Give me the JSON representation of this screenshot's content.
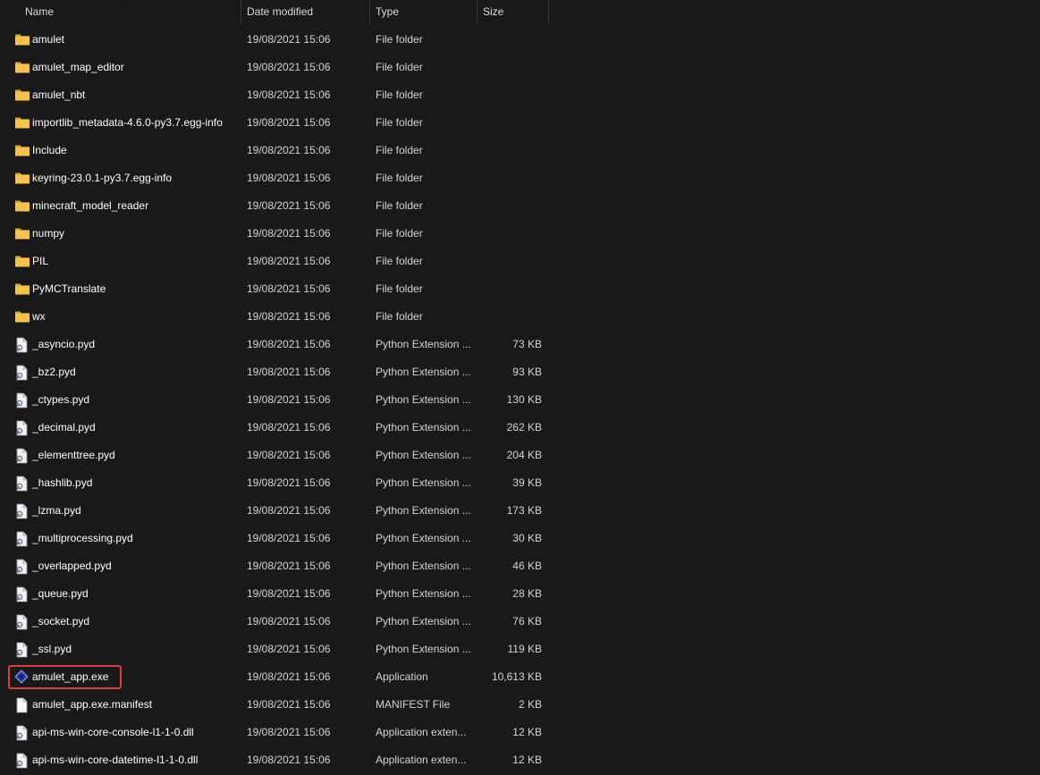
{
  "columns": {
    "name": "Name",
    "date": "Date modified",
    "type": "Type",
    "size": "Size"
  },
  "files": [
    {
      "name": "amulet",
      "date": "19/08/2021 15:06",
      "type": "File folder",
      "size": "",
      "icon": "folder-icon"
    },
    {
      "name": "amulet_map_editor",
      "date": "19/08/2021 15:06",
      "type": "File folder",
      "size": "",
      "icon": "folder-icon"
    },
    {
      "name": "amulet_nbt",
      "date": "19/08/2021 15:06",
      "type": "File folder",
      "size": "",
      "icon": "folder-icon"
    },
    {
      "name": "importlib_metadata-4.6.0-py3.7.egg-info",
      "date": "19/08/2021 15:06",
      "type": "File folder",
      "size": "",
      "icon": "folder-icon"
    },
    {
      "name": "Include",
      "date": "19/08/2021 15:06",
      "type": "File folder",
      "size": "",
      "icon": "folder-icon"
    },
    {
      "name": "keyring-23.0.1-py3.7.egg-info",
      "date": "19/08/2021 15:06",
      "type": "File folder",
      "size": "",
      "icon": "folder-icon"
    },
    {
      "name": "minecraft_model_reader",
      "date": "19/08/2021 15:06",
      "type": "File folder",
      "size": "",
      "icon": "folder-icon"
    },
    {
      "name": "numpy",
      "date": "19/08/2021 15:06",
      "type": "File folder",
      "size": "",
      "icon": "folder-icon"
    },
    {
      "name": "PIL",
      "date": "19/08/2021 15:06",
      "type": "File folder",
      "size": "",
      "icon": "folder-icon"
    },
    {
      "name": "PyMCTranslate",
      "date": "19/08/2021 15:06",
      "type": "File folder",
      "size": "",
      "icon": "folder-icon"
    },
    {
      "name": "wx",
      "date": "19/08/2021 15:06",
      "type": "File folder",
      "size": "",
      "icon": "folder-icon"
    },
    {
      "name": "_asyncio.pyd",
      "date": "19/08/2021 15:06",
      "type": "Python Extension ...",
      "size": "73 KB",
      "icon": "extension-file-icon"
    },
    {
      "name": "_bz2.pyd",
      "date": "19/08/2021 15:06",
      "type": "Python Extension ...",
      "size": "93 KB",
      "icon": "extension-file-icon"
    },
    {
      "name": "_ctypes.pyd",
      "date": "19/08/2021 15:06",
      "type": "Python Extension ...",
      "size": "130 KB",
      "icon": "extension-file-icon"
    },
    {
      "name": "_decimal.pyd",
      "date": "19/08/2021 15:06",
      "type": "Python Extension ...",
      "size": "262 KB",
      "icon": "extension-file-icon"
    },
    {
      "name": "_elementtree.pyd",
      "date": "19/08/2021 15:06",
      "type": "Python Extension ...",
      "size": "204 KB",
      "icon": "extension-file-icon"
    },
    {
      "name": "_hashlib.pyd",
      "date": "19/08/2021 15:06",
      "type": "Python Extension ...",
      "size": "39 KB",
      "icon": "extension-file-icon"
    },
    {
      "name": "_lzma.pyd",
      "date": "19/08/2021 15:06",
      "type": "Python Extension ...",
      "size": "173 KB",
      "icon": "extension-file-icon"
    },
    {
      "name": "_multiprocessing.pyd",
      "date": "19/08/2021 15:06",
      "type": "Python Extension ...",
      "size": "30 KB",
      "icon": "extension-file-icon"
    },
    {
      "name": "_overlapped.pyd",
      "date": "19/08/2021 15:06",
      "type": "Python Extension ...",
      "size": "46 KB",
      "icon": "extension-file-icon"
    },
    {
      "name": "_queue.pyd",
      "date": "19/08/2021 15:06",
      "type": "Python Extension ...",
      "size": "28 KB",
      "icon": "extension-file-icon"
    },
    {
      "name": "_socket.pyd",
      "date": "19/08/2021 15:06",
      "type": "Python Extension ...",
      "size": "76 KB",
      "icon": "extension-file-icon"
    },
    {
      "name": "_ssl.pyd",
      "date": "19/08/2021 15:06",
      "type": "Python Extension ...",
      "size": "119 KB",
      "icon": "extension-file-icon"
    },
    {
      "name": "amulet_app.exe",
      "date": "19/08/2021 15:06",
      "type": "Application",
      "size": "10,613 KB",
      "icon": "amulet-app-icon"
    },
    {
      "name": "amulet_app.exe.manifest",
      "date": "19/08/2021 15:06",
      "type": "MANIFEST File",
      "size": "2 KB",
      "icon": "blank-file-icon"
    },
    {
      "name": "api-ms-win-core-console-l1-1-0.dll",
      "date": "19/08/2021 15:06",
      "type": "Application exten...",
      "size": "12 KB",
      "icon": "extension-file-icon"
    },
    {
      "name": "api-ms-win-core-datetime-l1-1-0.dll",
      "date": "19/08/2021 15:06",
      "type": "Application exten...",
      "size": "12 KB",
      "icon": "extension-file-icon"
    }
  ],
  "colors": {
    "background": "#191919",
    "folder": "#f4c046",
    "highlight_border": "#e03c3c"
  }
}
